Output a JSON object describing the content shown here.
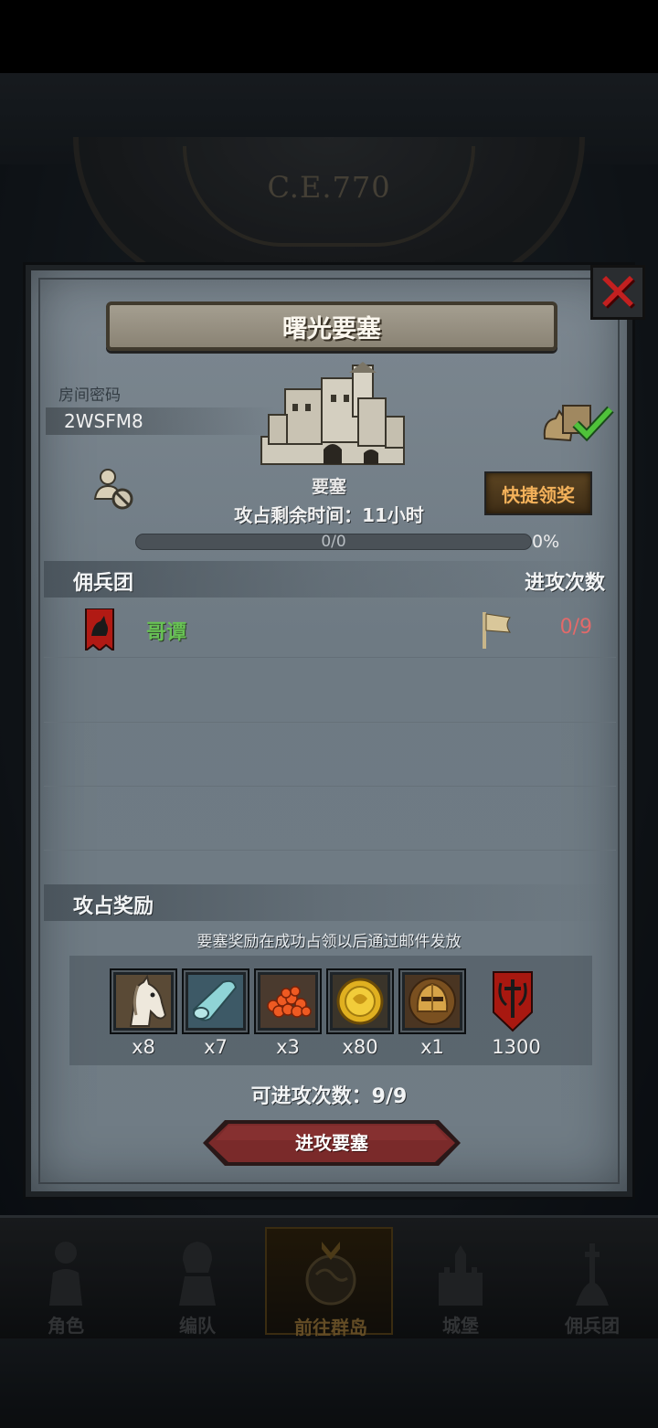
{
  "background": {
    "era": "C.E.770"
  },
  "dialog": {
    "title": "曙光要塞",
    "room_password_label": "房间密码",
    "room_code": "2WSFM8",
    "fortress_label": "要塞",
    "quick_claim_label": "快捷领奖",
    "time_remaining": "攻占剩余时间：11小时",
    "progress": {
      "text": "0/0",
      "percent_label": "0%",
      "fill_fraction": 0
    },
    "mercenary_header": {
      "left": "佣兵团",
      "right": "进攻次数"
    },
    "mercenaries": [
      {
        "name": "哥谭",
        "attacks": "0/9"
      }
    ],
    "reward_header": "攻占奖励",
    "reward_note": "要塞奖励在成功占领以后通过邮件发放",
    "rewards": [
      {
        "icon": "horse-icon",
        "qty": "x8"
      },
      {
        "icon": "cloth-icon",
        "qty": "x7"
      },
      {
        "icon": "berries-icon",
        "qty": "x3"
      },
      {
        "icon": "gold-coin-icon",
        "qty": "x80"
      },
      {
        "icon": "knight-helmet-icon",
        "qty": "x1"
      },
      {
        "icon": "banner-emblem-icon",
        "qty": "1300"
      }
    ],
    "attempts_label": "可进攻次数：9/9",
    "attack_button_label": "进攻要塞"
  },
  "nav": {
    "items": [
      {
        "label": "角色",
        "icon": "character-icon",
        "active": false
      },
      {
        "label": "编队",
        "icon": "formation-icon",
        "active": false
      },
      {
        "label": "前往群岛",
        "icon": "globe-icon",
        "active": true
      },
      {
        "label": "城堡",
        "icon": "castle-icon",
        "active": false
      },
      {
        "label": "佣兵团",
        "icon": "mercenary-icon",
        "active": false
      }
    ]
  },
  "colors": {
    "merc_name": "#68c254",
    "attack_count": "#e26a6a",
    "quick_claim_text": "#f3b15a",
    "close_x": "#c22020"
  }
}
